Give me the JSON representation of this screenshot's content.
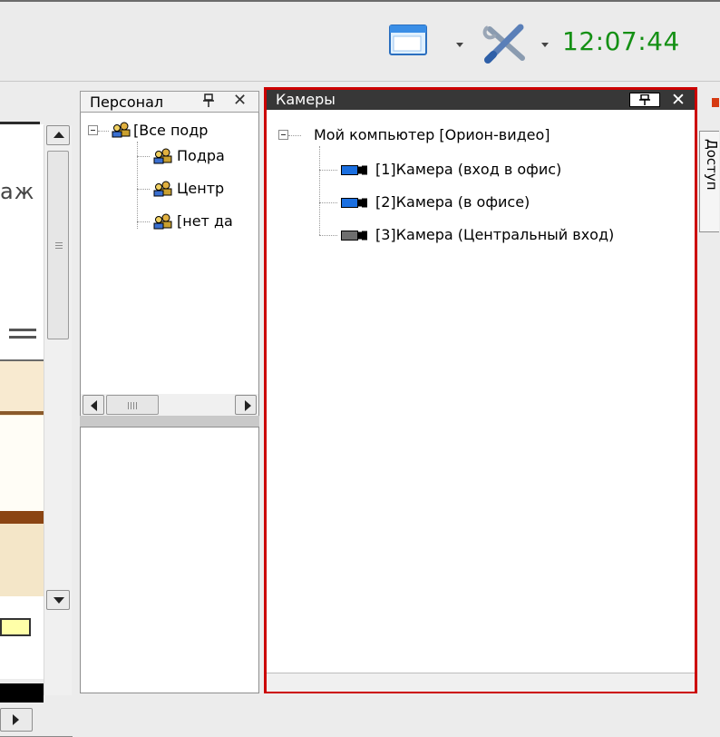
{
  "toolbar": {
    "window_icon": "window-icon",
    "tools_icon": "tools-icon",
    "clock": "12:07:44",
    "clock_color": "#159015"
  },
  "left_panel": {
    "partial_text": "аж"
  },
  "personal_panel": {
    "title": "Персонал",
    "pin_icon": "pin-icon",
    "close_icon": "close-icon",
    "tree": [
      {
        "label": "[Все подр",
        "level": 0
      },
      {
        "label": "Подра",
        "level": 1
      },
      {
        "label": "Центр",
        "level": 1
      },
      {
        "label": "[нет да",
        "level": 1
      }
    ]
  },
  "cameras_panel": {
    "title": "Камеры",
    "highlight_color": "#cc0000",
    "root_label": "Мой компьютер [Орион-видео]",
    "cameras": [
      {
        "label": "[1]Камера (вход в офис)",
        "color": "#1b6fe0"
      },
      {
        "label": "[2]Камера (в офисе)",
        "color": "#1b6fe0"
      },
      {
        "label": "[3]Камера (Центральный вход)",
        "color": "#6e6e6e"
      }
    ]
  },
  "right_strip": {
    "tab_label": "Доступ"
  }
}
